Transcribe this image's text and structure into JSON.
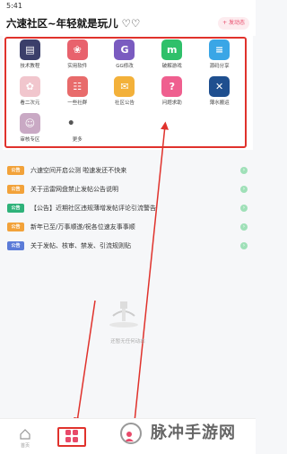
{
  "status": {
    "time": "5:41"
  },
  "header": {
    "title": "六速社区~年轻就是玩儿 ♡♡",
    "publish_label": "+ 发动态"
  },
  "grid": [
    {
      "label": "技术教程",
      "icon": "tutorial-icon",
      "color": "#3b3f6a",
      "glyph": "▤"
    },
    {
      "label": "实用软件",
      "icon": "software-icon",
      "color": "#e8626d",
      "glyph": "❀"
    },
    {
      "label": "GG修改",
      "icon": "gg-icon",
      "color": "#7a5bc0",
      "glyph": "G"
    },
    {
      "label": "破解游戏",
      "icon": "game-icon",
      "color": "#2fc06a",
      "glyph": "m"
    },
    {
      "label": "源码分享",
      "icon": "code-icon",
      "color": "#3aa6e6",
      "glyph": "≡"
    },
    {
      "label": "看二次元",
      "icon": "anime-icon",
      "color": "#f1c6cd",
      "glyph": "✿"
    },
    {
      "label": "一些社群",
      "icon": "group-icon",
      "color": "#e86b6b",
      "glyph": "☷"
    },
    {
      "label": "社区公告",
      "icon": "notice-icon",
      "color": "#f3b13a",
      "glyph": "✉"
    },
    {
      "label": "问题求助",
      "icon": "help-icon",
      "color": "#ef5f8f",
      "glyph": "?"
    },
    {
      "label": "薄水搬运",
      "icon": "transfer-icon",
      "color": "#1f4f8f",
      "glyph": "✕"
    },
    {
      "label": "审核专区",
      "icon": "review-icon",
      "color": "#c9a9c4",
      "glyph": "☺"
    },
    {
      "label": "更多",
      "icon": "more-icon",
      "color": "transparent",
      "glyph": "• • •"
    }
  ],
  "announcements": [
    {
      "badge": "公告",
      "badge_color": "#f2a23a",
      "text": "六速空间开启公测 啦速发还不快来"
    },
    {
      "badge": "公告",
      "badge_color": "#f2a23a",
      "text": "关于迅雷网盘禁止发帖公告说明"
    },
    {
      "badge": "公告",
      "badge_color": "#2fb27a",
      "text": "【公告】近期社区违规薄增发帖评论引流警告"
    },
    {
      "badge": "公告",
      "badge_color": "#f2a23a",
      "text": "新年已至/万事顺遂/祝各位速友事事顺"
    },
    {
      "badge": "公告",
      "badge_color": "#5b7bd8",
      "text": "关于发帖、核审、禁发、引流规则贴"
    }
  ],
  "empty_state": {
    "text": "还暂无任何动态"
  },
  "tabbar": {
    "home_label": "首页"
  },
  "watermark": {
    "text": "脉冲手游网"
  }
}
